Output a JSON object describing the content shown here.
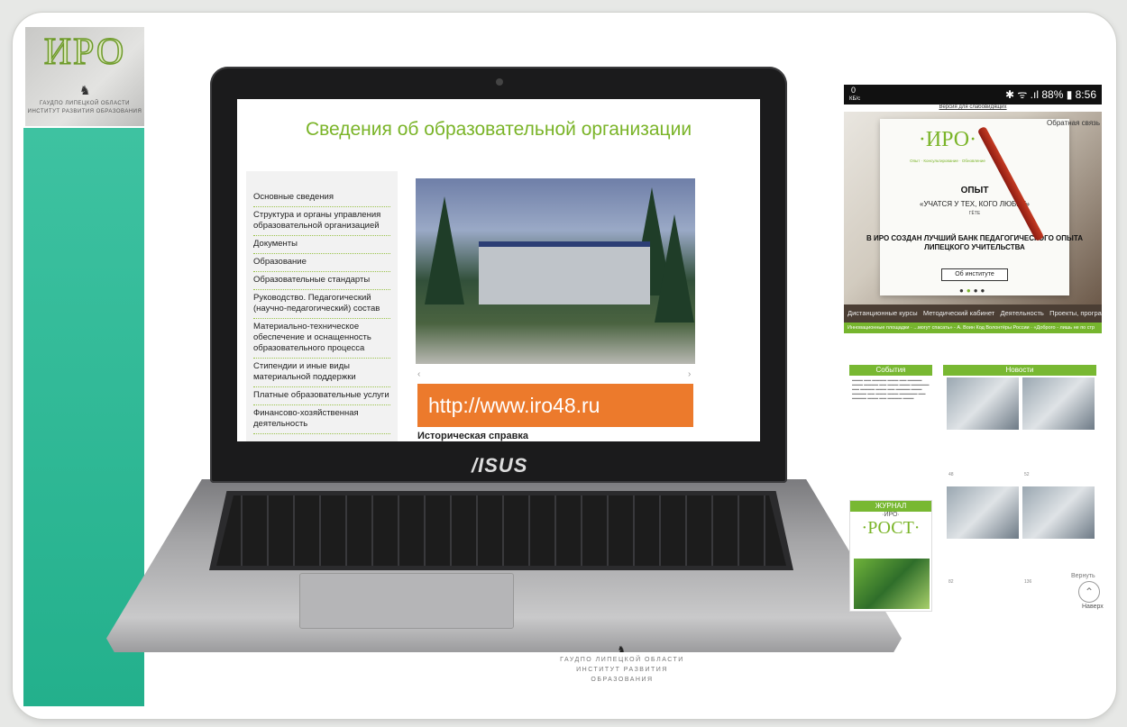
{
  "logo": {
    "word": "ИРО",
    "line1": "ГАУДПО ЛИПЕЦКОЙ ОБЛАСТИ",
    "line2": "ИНСТИТУТ РАЗВИТИЯ ОБРАЗОВАНИЯ"
  },
  "laptop": {
    "brand": "/ISUS",
    "screen_title": "Сведения об образовательной организации",
    "menu_items": [
      "Основные сведения",
      "Структура и органы управления образовательной организацией",
      "Документы",
      "Образование",
      "Образовательные стандарты",
      "Руководство. Педагогический (научно-педагогический) состав",
      "Материально-техническое обеспечение и оснащенность образовательного процесса",
      "Стипендии и иные виды материальной поддержки",
      "Платные образовательные услуги",
      "Финансово-хозяйственная деятельность"
    ],
    "url": "http://www.iro48.ru",
    "cut_heading": "Историческая справка"
  },
  "phone": {
    "status_left_top": "0",
    "status_left_bottom": "КБ/с",
    "status_right": "✱ ᯤ .ıl 88% ▮ 8:56",
    "top_link": "Версия для слабовидящих",
    "card_logo": "·ИРО·",
    "card_tagline": "Опыт · Консультирование · Обновление",
    "feedback": "Обратная связь",
    "heading": "ОПЫТ",
    "quote": "«УЧАТСЯ У ТЕХ, КОГО ЛЮБЯТ»",
    "quote_author": "ГЁТЕ",
    "announce": "В ИРО СОЗДАН ЛУЧШИЙ БАНК ПЕДАГОГИЧЕСКОГО ОПЫТА ЛИПЕЦКОГО УЧИТЕЛЬСТВА",
    "about_btn": "Об институте",
    "nav": [
      "Дистанционные курсы",
      "Методический кабинет",
      "Деятельность",
      "Проекты, программы"
    ],
    "ticker": "Инновационные площадки · ...могут спасать» - А. Воин Код Волонтёры России · «Доброго - лишь не по стр"
  },
  "lower": {
    "events_title": "События",
    "news_title": "Новости",
    "journal_label": "ЖУРНАЛ",
    "journal_logo_small": "·ИРО·",
    "journal_logo": "·РОСТ·",
    "news_counts": [
      "48",
      "52",
      "82",
      "136"
    ],
    "to_top": "Наверх",
    "back": "Вернуть"
  },
  "footer": {
    "line1": "ГАУДПО ЛИПЕЦКОЙ ОБЛАСТИ",
    "line2": "ИНСТИТУТ РАЗВИТИЯ ОБРАЗОВАНИЯ"
  }
}
